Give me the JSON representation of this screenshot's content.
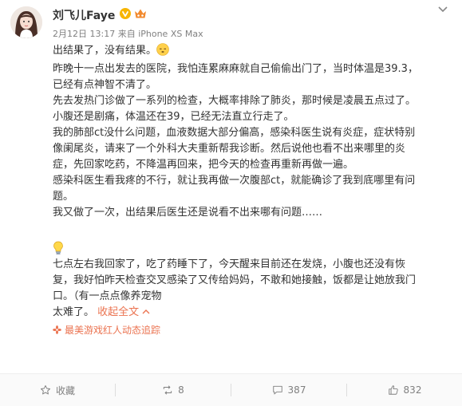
{
  "post": {
    "author": "刘飞儿Faye",
    "meta": {
      "date": "2月12日 13:17",
      "source": "来自 iPhone XS Max"
    },
    "lines": [
      "出结果了，没有结果。",
      "昨晚十一点出发去的医院，我怕连累麻麻就自己偷偷出门了，当时体温是39.3，",
      "已经有点神智不清了。",
      "先去发热门诊做了一系列的检查，大概率排除了肺炎，那时候是凌晨五点过了。",
      "小腹还是剧痛，体温还在39，已经无法直立行走了。",
      "我的肺部ct没什么问题，血液数据大部分偏高，感染科医生说有炎症，症状特别",
      "像阑尾炎，请来了一个外科大夫重新帮我诊断。然后说他也看不出来哪里的炎",
      "症，先回家吃药，不降温再回来，把今天的检查再重新再做一遍。",
      "感染科医生看我疼的不行，就让我再做一次腹部ct，就能确诊了我到底哪里有问",
      "题。",
      "我又做了一次，出结果后医生还是说看不出来哪有问题……",
      "七点左右我回家了，吃了药睡下了，今天醒来目前还在发烧，小腹也还没有恢",
      "复，我好怕昨天检查交叉感染了又传给妈妈，不敢和她接触，饭都是让她放我门",
      "口。（有一点点像养宠物",
      "太难了。"
    ],
    "collapse_label": "收起全文",
    "tail_label": "最美游戏红人动态追踪"
  },
  "actions": {
    "collect": "收藏",
    "repost": "8",
    "comment": "387",
    "like": "832"
  },
  "colors": {
    "accent": "#eb7350",
    "muted": "#808080",
    "text": "#333333",
    "verified": "#f7b500"
  },
  "icons": [
    "verified-v-icon",
    "vip-badge-icon",
    "more-chevron-icon",
    "star-icon",
    "repost-icon",
    "comment-icon",
    "thumbs-up-icon",
    "lightbulb-emoji",
    "sleepy-face-emoji",
    "fan-icon"
  ]
}
